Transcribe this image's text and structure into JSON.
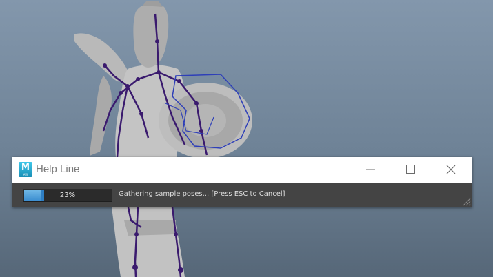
{
  "window": {
    "title": "Help Line",
    "app_icon_letter": "M",
    "app_icon_sub": "AW"
  },
  "controls": {
    "minimize_icon": "minimize-icon",
    "maximize_icon": "maximize-icon",
    "close_icon": "close-icon"
  },
  "status": {
    "progress_percent": 23,
    "progress_text": "23%",
    "message": "Gathering sample poses... [Press ESC to Cancel]"
  },
  "colors": {
    "viewport_top": "#8397ac",
    "viewport_bottom": "#566778",
    "titlebar": "#ffffff",
    "statusbar": "#444444",
    "progress_fill": "#3d8fd1",
    "skeleton": "#3a1a6e",
    "shield_curve": "#2e3fb8"
  }
}
